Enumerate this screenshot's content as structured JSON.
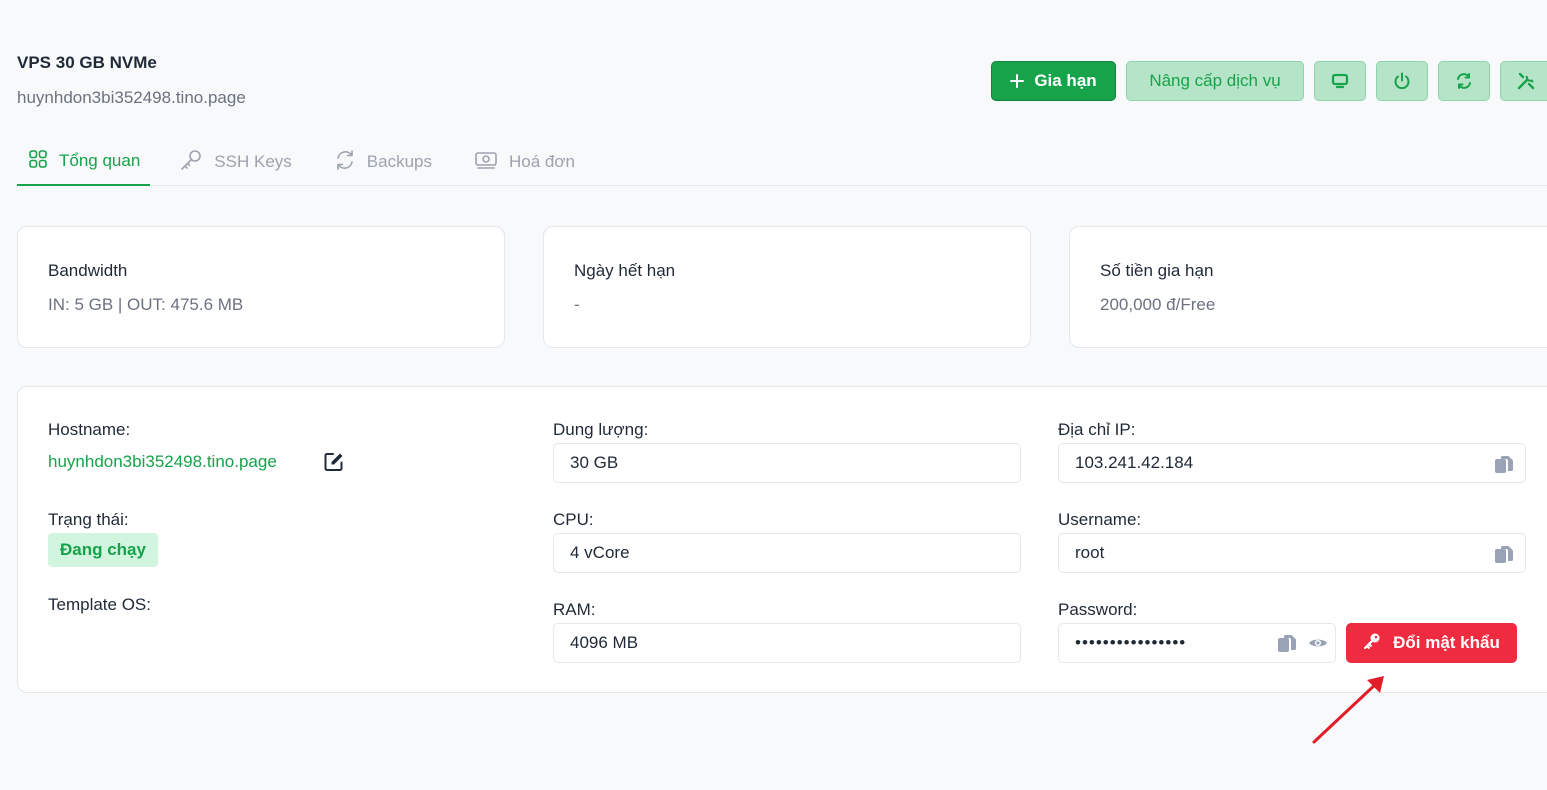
{
  "header": {
    "title": "VPS 30 GB NVMe",
    "hostname": "huynhdon3bi352498.tino.page"
  },
  "actions": {
    "renew_label": "Gia hạn",
    "upgrade_label": "Nâng cấp dịch vụ",
    "icon_buttons": [
      "monitor-icon",
      "power-icon",
      "refresh-icon",
      "tools-icon"
    ]
  },
  "tabs": [
    {
      "label": "Tổng quan",
      "icon": "grid-icon",
      "active": true
    },
    {
      "label": "SSH Keys",
      "icon": "key-icon",
      "active": false
    },
    {
      "label": "Backups",
      "icon": "refresh-icon",
      "active": false
    },
    {
      "label": "Hoá đơn",
      "icon": "money-icon",
      "active": false
    }
  ],
  "stats": [
    {
      "label": "Bandwidth",
      "value": "IN: 5 GB | OUT: 475.6 MB"
    },
    {
      "label": "Ngày hết hạn",
      "value": "-"
    },
    {
      "label": "Số tiền gia hạn",
      "value": "200,000 đ/Free"
    }
  ],
  "details": {
    "hostname_label": "Hostname:",
    "hostname_value": "huynhdon3bi352498.tino.page",
    "status_label": "Trạng thái:",
    "status_value": "Đang chạy",
    "os_label": "Template OS:",
    "storage_label": "Dung lượng:",
    "storage_value": "30 GB",
    "cpu_label": "CPU:",
    "cpu_value": "4 vCore",
    "ram_label": "RAM:",
    "ram_value": "4096 MB",
    "ip_label": "Địa chỉ IP:",
    "ip_value": "103.241.42.184",
    "username_label": "Username:",
    "username_value": "root",
    "password_label": "Password:",
    "password_mask": "••••••••••••••••",
    "change_password_label": "Đổi mật khẩu"
  },
  "colors": {
    "primary": "#16a34a",
    "soft_green": "#b6e4c8",
    "danger": "#ef2b3f",
    "annotation_arrow": "#e11d2a"
  }
}
